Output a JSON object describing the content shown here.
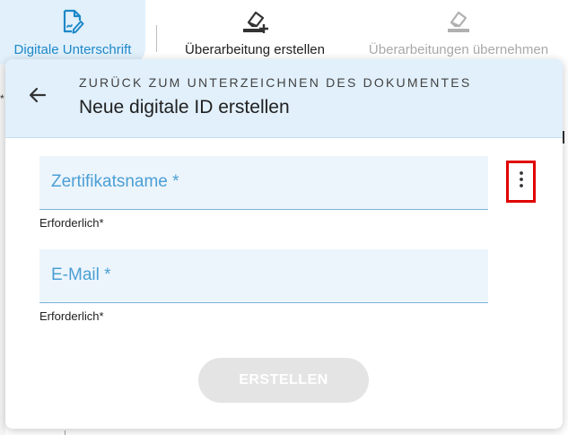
{
  "toolbar": {
    "tabs": [
      {
        "label": "Digitale Unterschrift",
        "icon": "document-signature-icon",
        "active": true
      },
      {
        "label": "Überarbeitung erstellen",
        "icon": "eraser-add-icon",
        "active": false
      },
      {
        "label": "Überarbeitungen übernehmen",
        "icon": "eraser-icon",
        "active": false,
        "disabled": true
      }
    ]
  },
  "panel": {
    "back_icon": "arrow-left-icon",
    "subtitle": "ZURÜCK ZUM UNTERZEICHNEN DES DOKUMENTES",
    "title": "Neue digitale ID erstellen",
    "menu_icon": "more-vertical-icon",
    "fields": [
      {
        "label": "Zertifikatsname *",
        "value": "",
        "hint": "Erforderlich*"
      },
      {
        "label": "E-Mail *",
        "value": "",
        "hint": "Erforderlich*"
      }
    ],
    "submit_label": "ERSTELLEN"
  },
  "colors": {
    "accent": "#1e88c8",
    "header_bg": "#e1f0fb",
    "field_bg": "#edf5fc",
    "field_label": "#4a9fd4",
    "highlight_box": "#e00000",
    "disabled_button": "#e4e4e4"
  }
}
